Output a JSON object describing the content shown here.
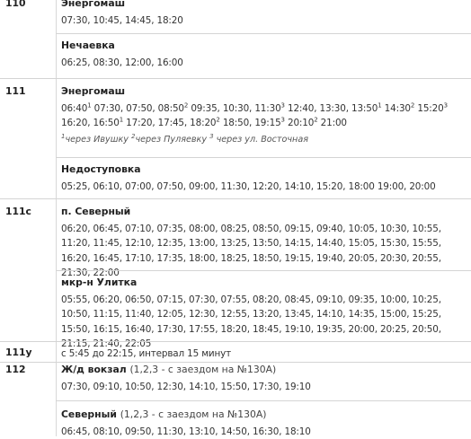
{
  "routes": [
    {
      "number": "110"
    },
    {
      "number": "111"
    },
    {
      "number": "111с"
    },
    {
      "number": "111у"
    },
    {
      "number": "112"
    }
  ],
  "r110": {
    "stop1": {
      "name": "Энергомаш",
      "times": "07:30, 10:45, 14:45, 18:20"
    },
    "stop2": {
      "name": "Нечаевка",
      "times": "06:25, 08:30, 12:00, 16:00"
    }
  },
  "r111": {
    "stop1": {
      "name": "Энергомаш",
      "times_html": "06:40<sup>1</sup> 07:30, 07:50, 08:50<sup>2</sup> 09:35, 10:30, 11:30<sup>3</sup> 12:40, 13:30, 13:50<sup>1</sup> 14:30<sup>2</sup> 15:20<sup>3</sup> 16:20, 16:50<sup>1</sup> 17:20, 17:45, 18:20<sup>2</sup> 18:50, 19:15<sup>3</sup> 20:10<sup>2</sup> 21:00",
      "note_html": "<sup>1</sup>через Ивушку <sup>2</sup>через Пуляевку <sup>3</sup> через ул. Восточная"
    },
    "stop2": {
      "name": "Недоступовка",
      "times": "05:25, 06:10, 07:00, 07:50, 09:00, 11:30, 12:20, 14:10, 15:20, 18:00 19:00, 20:00"
    }
  },
  "r111s": {
    "stop1": {
      "name": "п. Северный",
      "times": "06:20, 06:45, 07:10, 07:35, 08:00, 08:25, 08:50, 09:15, 09:40, 10:05, 10:30, 10:55, 11:20, 11:45, 12:10, 12:35, 13:00, 13:25, 13:50, 14:15, 14:40, 15:05, 15:30, 15:55, 16:20, 16:45, 17:10, 17:35, 18:00, 18:25, 18:50, 19:15, 19:40, 20:05, 20:30, 20:55, 21:30, 22:00"
    },
    "stop2": {
      "name": "мкр-н Улитка",
      "times": "05:55, 06:20, 06:50, 07:15, 07:30, 07:55, 08:20, 08:45, 09:10, 09:35, 10:00, 10:25, 10:50, 11:15, 11:40, 12:05, 12:30, 12:55, 13:20, 13:45, 14:10, 14:35, 15:00, 15:25, 15:50, 16:15, 16:40, 17:30, 17:55, 18:20, 18:45, 19:10, 19:35, 20:00, 20:25, 20:50, 21:15, 21:40, 22:05"
    }
  },
  "r111u": {
    "text": "с 5:45 до 22:15, интервал 15 минут"
  },
  "r112": {
    "stop1": {
      "name": "Ж/д вокзал",
      "note": "(1,2,3 - с заездом на №130А)",
      "times": "07:30, 09:10, 10:50, 12:30, 14:10, 15:50, 17:30, 19:10"
    },
    "stop2": {
      "name": "Северный",
      "note": "(1,2,3 - с заездом на №130А)",
      "times": "06:45, 08:10, 09:50, 11:30, 13:10, 14:50, 16:30, 18:10"
    }
  }
}
